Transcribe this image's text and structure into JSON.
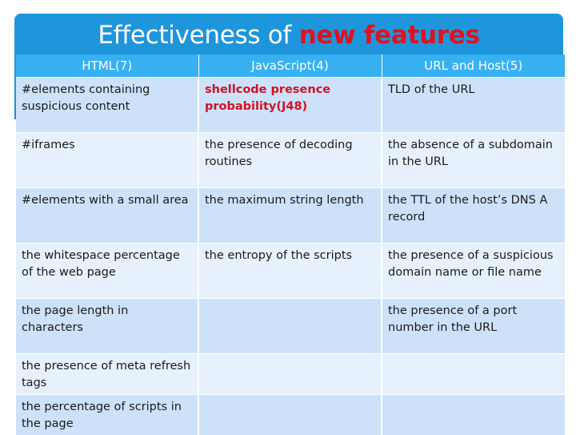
{
  "title": {
    "prefix": "Effectiveness of ",
    "highlight": "new features",
    "highlight_color": "#e3101d"
  },
  "colors": {
    "banner": "#1f97dd",
    "header_row": "#37b1f2",
    "row_dark": "#cde2f9",
    "row_light": "#e6f1fd",
    "highlight_text": "#d11226"
  },
  "table": {
    "headers": [
      "HTML(7)",
      "JavaScript(4)",
      "URL and Host(5)"
    ],
    "rows": [
      {
        "html": "#elements containing suspicious content",
        "javascript": "shellcode presence probability(J48)",
        "javascript_highlighted": true,
        "url_host": "TLD of the URL"
      },
      {
        "html": "#iframes",
        "javascript": "the presence of decoding routines",
        "url_host": "the absence of a subdomain in the URL"
      },
      {
        "html": "#elements with a small area",
        "javascript": "the maximum string length",
        "url_host": "the TTL of the host’s DNS A record"
      },
      {
        "html": "the whitespace percentage of the web page",
        "javascript": "the entropy of the scripts",
        "url_host": "the presence of a suspicious domain name or file name"
      },
      {
        "html": "the page length in characters",
        "javascript": "",
        "url_host": "the presence of a port number in the URL"
      },
      {
        "html": "the presence of meta refresh tags",
        "javascript": "",
        "url_host": ""
      },
      {
        "html": "the percentage of scripts in the page",
        "javascript": "",
        "url_host": ""
      }
    ]
  }
}
